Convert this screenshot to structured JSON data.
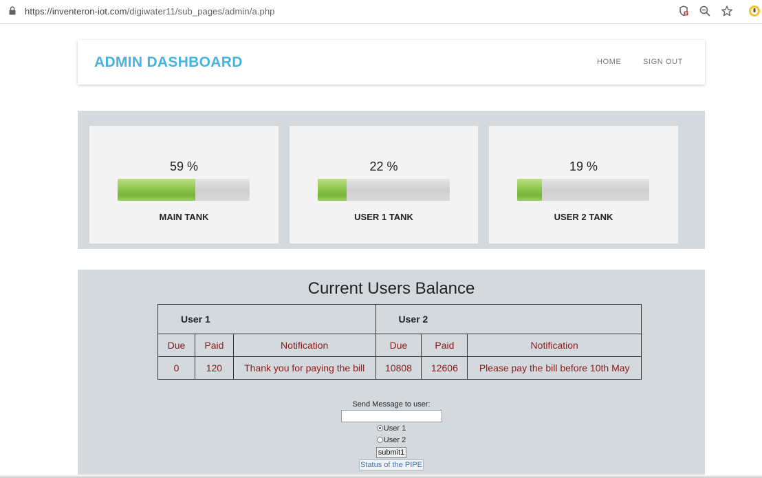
{
  "browser": {
    "url_host": "https://inventeron-iot.com",
    "url_path": "/digiwater11/sub_pages/admin/a.php"
  },
  "header": {
    "title": "ADMIN DASHBOARD",
    "nav": [
      "HOME",
      "SIGN OUT"
    ]
  },
  "tanks": [
    {
      "name": "MAIN TANK",
      "percent_label": "59 %",
      "level": 59
    },
    {
      "name": "USER 1 TANK",
      "percent_label": "22 %",
      "level": 22
    },
    {
      "name": "USER 2 TANK",
      "percent_label": "19 %",
      "level": 19
    }
  ],
  "balance": {
    "title": "Current Users Balance",
    "users": [
      "User 1",
      "User 2"
    ],
    "columns": [
      "Due",
      "Paid",
      "Notification",
      "Due",
      "Paid",
      "Notification"
    ],
    "row": [
      "0",
      "120",
      "Thank you for paying the bill",
      "10808",
      "12606",
      "Please pay the bill before 10th May"
    ]
  },
  "form": {
    "label": "Send Message to user:",
    "message_value": "",
    "radios": [
      {
        "label": "User 1",
        "checked": true
      },
      {
        "label": "User 2",
        "checked": false
      }
    ],
    "submit_label": "submit1",
    "pipe_label": "Status of the PIPE"
  },
  "colors": {
    "brand": "#45b3e0",
    "table_text": "#8b1a1a",
    "panel_bg": "#d4d9dd",
    "bar_fill": "#8bc34a"
  }
}
